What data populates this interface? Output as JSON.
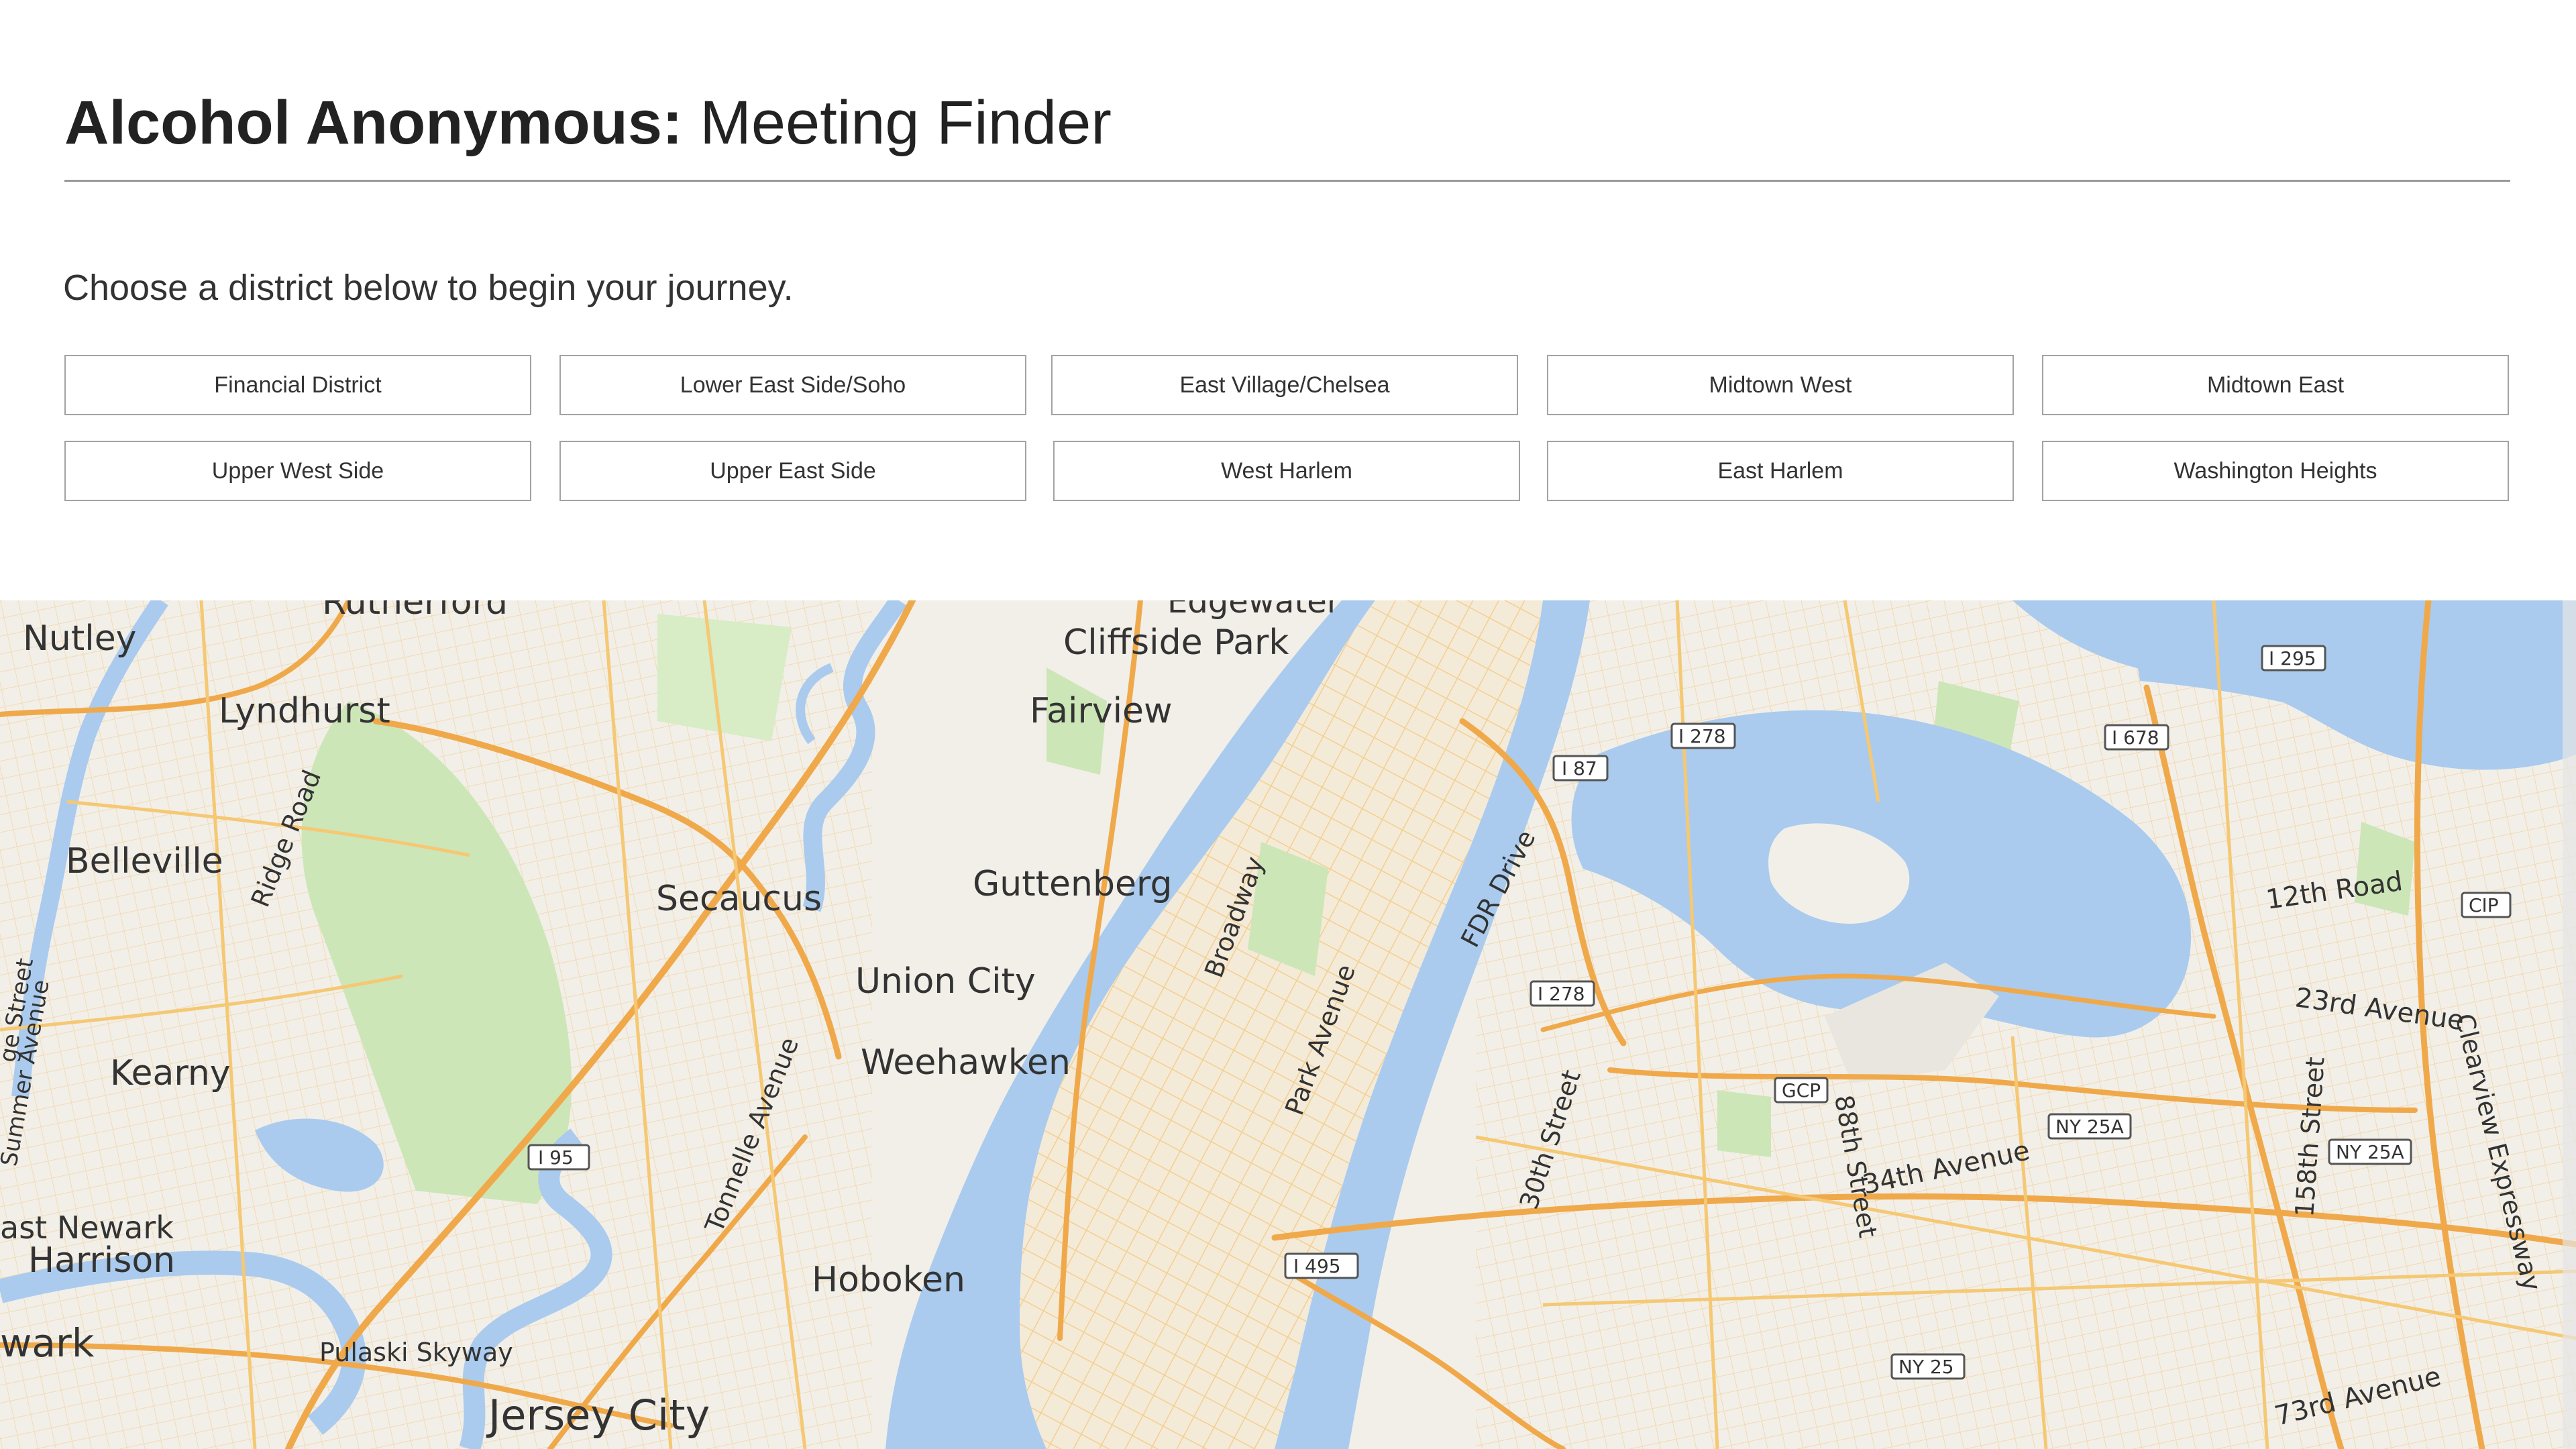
{
  "header": {
    "brand": "Alcohol Anonymous:",
    "title": " Meeting Finder"
  },
  "intro": "Choose a district below to begin your journey.",
  "districts": [
    "Financial District",
    "Lower East Side/Soho",
    "East Village/Chelsea",
    "Midtown West",
    "Midtown East",
    "Upper West Side",
    "Upper East Side",
    "West Harlem",
    "East Harlem",
    "Washington Heights"
  ],
  "map": {
    "places": {
      "rutherford": "Rutherford",
      "edgewater": "Edgewater",
      "nutley": "Nutley",
      "cliffside_park": "Cliffside Park",
      "lyndhurst": "Lyndhurst",
      "fairview": "Fairview",
      "belleville": "Belleville",
      "ridge_road": "Ridge Road",
      "secaucus": "Secaucus",
      "guttenberg": "Guttenberg",
      "union_city": "Union City",
      "weehawken": "Weehawken",
      "kearny": "Kearny",
      "east_newark": "ast Newark",
      "harrison": "Harrison",
      "hoboken": "Hoboken",
      "newark": "wark",
      "pulaski_skyway": "Pulaski Skyway",
      "jersey_city": "Jersey City",
      "broadway": "Broadway",
      "park_avenue": "Park Avenue",
      "fdr_drive": "FDR Drive",
      "tonnelle_avenue": "Tonnelle Avenue",
      "thirtieth_street": "30th Street",
      "eightyeighth_street": "88th Street",
      "thirtyfourth_avenue": "34th Avenue",
      "twelfth_road": "12th Road",
      "twentythird_avenue": "23rd Avenue",
      "clearview_expressway": "Clearview Expressway",
      "onefiftyeighth_street": "158th Street",
      "seventythird_avenue": "73rd Avenue",
      "summer_avenue": "Summer Avenue",
      "ridge_street": "ge Street"
    },
    "shields": {
      "i295": "I 295",
      "i278a": "I 278",
      "i678": "I 678",
      "i87": "I 87",
      "cip": "CIP",
      "i278b": "I 278",
      "gcp": "GCP",
      "ny25a_a": "NY 25A",
      "ny25a_b": "NY 25A",
      "i95": "I 95",
      "i495": "I 495",
      "ny25": "NY 25"
    },
    "colors": {
      "water": "#aacbee",
      "land": "#f2efe9",
      "park": "#cde6b8",
      "major_road": "#f0a94a",
      "minor_road": "#f7d08a"
    }
  }
}
